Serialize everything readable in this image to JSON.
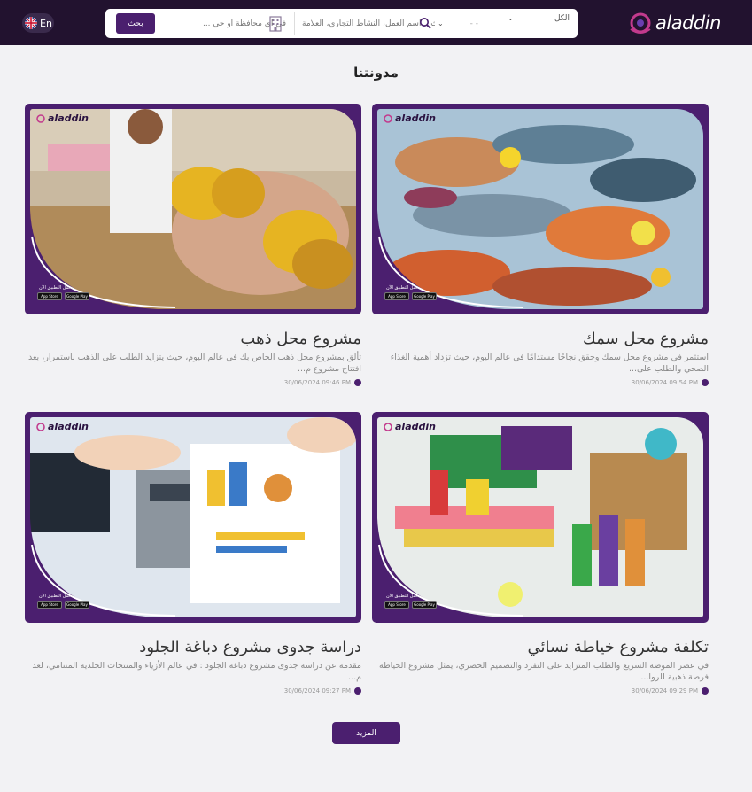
{
  "header": {
    "brand": "aladdin",
    "lang_label": "En",
    "search": {
      "button_label": "بحث",
      "location_placeholder": "... في أي محافظة أو حي",
      "keyword_placeholder": "ابحث بـ اسم العمل، النشاط التجاري، العلامة",
      "city_value": "- -",
      "category_value": "الكل"
    },
    "colors": {
      "header_bg": "#22122f",
      "accent": "#4b1f6f"
    }
  },
  "page": {
    "title": "مدونتنا"
  },
  "posts": [
    {
      "title": "مشروع محل سمك",
      "excerpt": "استثمر في مشروع محل سمك وحقق نجاحًا مستدامًا في عالم اليوم، حيث تزداد أهمية الغذاء الصحي والطلب على...",
      "date": "30/06/2024 09:54 PM",
      "image_icon": "seafood-photo"
    },
    {
      "title": "مشروع محل ذهب",
      "excerpt": "تألق بمشروع محل ذهب الخاص بك في عالم اليوم، حيث يتزايد الطلب على الذهب باستمرار، بعد افتتاح مشروع م...",
      "date": "30/06/2024 09:46 PM",
      "image_icon": "gold-bracelets-photo"
    },
    {
      "title": "تكلفة مشروع خياطة نسائي",
      "excerpt": "في عصر الموضة السريع والطلب المتزايد على التفرد والتصميم الحصري، يمثل مشروع الخياطة فرصة ذهبية للروا...",
      "date": "30/06/2024 09:29 PM",
      "image_icon": "sewing-threads-photo"
    },
    {
      "title": "دراسة جدوى مشروع دباغة الجلود",
      "excerpt": "مقدمة عن دراسة جدوى مشروع دباغة الجلود : في عالم الأزياء والمنتجات الجلدية المتنامي، لعد م...",
      "date": "30/06/2024 09:27 PM",
      "image_icon": "finance-charts-photo"
    }
  ],
  "card_brand": "aladdin",
  "store_caption": "حمل التطبيق الآن",
  "store_badges": [
    "App Store",
    "Google Play"
  ],
  "more_button_label": "المزيد"
}
